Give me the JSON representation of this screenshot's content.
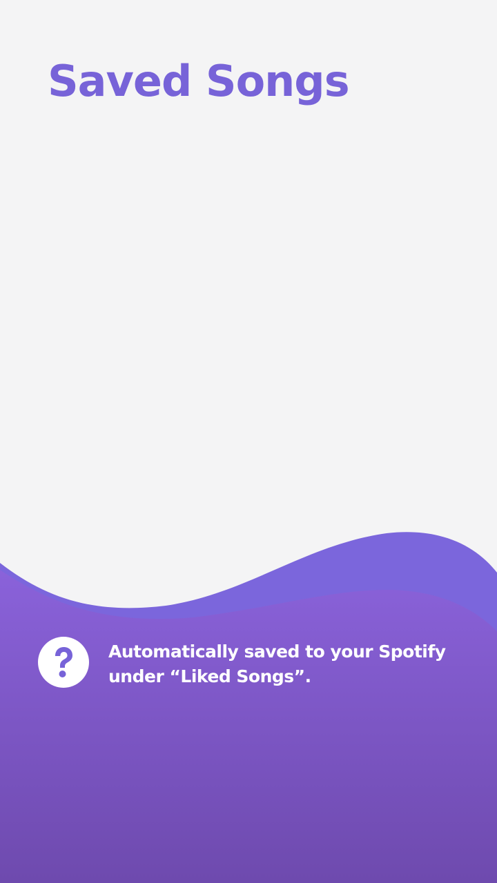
{
  "page": {
    "title": "Saved Songs"
  },
  "info": {
    "icon": "help-circle-icon",
    "text": "Automatically saved to your Spotify under “Liked Songs”."
  },
  "colors": {
    "background": "#f4f4f5",
    "accent": "#7763d8",
    "wave_top": "#7d66dc",
    "wave_bottom": "#6e4aae",
    "text_on_wave": "#ffffff"
  }
}
